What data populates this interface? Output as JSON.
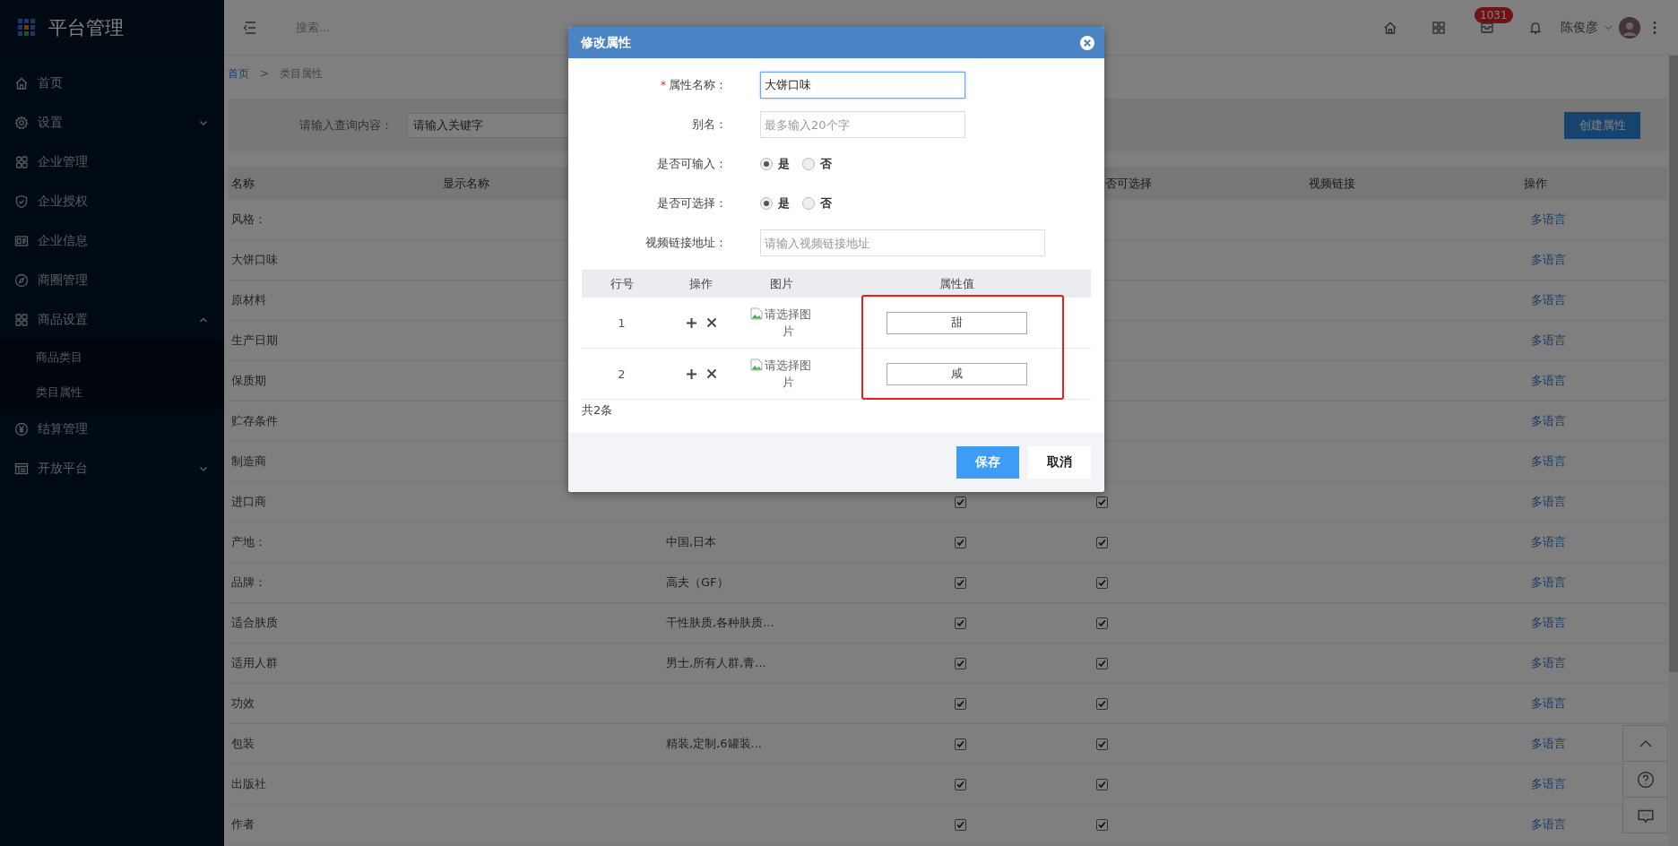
{
  "sidebar": {
    "title": "平台管理",
    "items": [
      {
        "label": "首页"
      },
      {
        "label": "设置",
        "expanded": false
      },
      {
        "label": "企业管理"
      },
      {
        "label": "企业授权"
      },
      {
        "label": "企业信息"
      },
      {
        "label": "商圈管理"
      },
      {
        "label": "商品设置",
        "expanded": true,
        "children": [
          {
            "label": "商品类目"
          },
          {
            "label": "类目属性"
          }
        ]
      },
      {
        "label": "结算管理"
      },
      {
        "label": "开放平台",
        "expanded": false
      }
    ]
  },
  "header": {
    "search_placeholder": "搜索...",
    "badge": "1031",
    "user": "陈俊彦"
  },
  "breadcrumb": {
    "home": "首页",
    "separator": ">",
    "current": "类目属性"
  },
  "filter": {
    "label": "请输入查询内容：",
    "placeholder": "请输入关键字",
    "create_button": "创建属性"
  },
  "table": {
    "columns": {
      "name": "名称",
      "display_name": "显示名称",
      "column_5": "否可选择",
      "video": "视频链接",
      "actions": "操作"
    },
    "rows": [
      {
        "name": "风格：",
        "link": "多语言"
      },
      {
        "name": "大饼口味",
        "link": "多语言"
      },
      {
        "name": "原材料",
        "link": "多语言"
      },
      {
        "name": "生产日期",
        "link": "多语言"
      },
      {
        "name": "保质期",
        "link": "多语言"
      },
      {
        "name": "贮存条件",
        "link": "多语言"
      },
      {
        "name": "制造商",
        "link": "多语言"
      },
      {
        "name": "进口商",
        "column_4_checked": true,
        "column_5_checked": true,
        "link": "多语言"
      },
      {
        "name": "产地：",
        "values": "中国,日本",
        "column_4_checked": true,
        "column_5_checked": true,
        "link": "多语言"
      },
      {
        "name": "品牌：",
        "values": "高夫（GF）",
        "column_4_checked": true,
        "column_5_checked": true,
        "link": "多语言"
      },
      {
        "name": "适合肤质",
        "values": "干性肤质,各种肤质...",
        "column_4_checked": true,
        "column_5_checked": true,
        "link": "多语言"
      },
      {
        "name": "适用人群",
        "values": "男士,所有人群,青...",
        "column_4_checked": true,
        "column_5_checked": true,
        "link": "多语言"
      },
      {
        "name": "功效",
        "column_4_checked": true,
        "column_5_checked": true,
        "link": "多语言"
      },
      {
        "name": "包装",
        "values": "精装,定制,6罐装...",
        "column_4_checked": true,
        "column_5_checked": true,
        "link": "多语言"
      },
      {
        "name": "出版社",
        "column_4_checked": true,
        "column_5_checked": true,
        "link": "多语言"
      },
      {
        "name": "作者",
        "column_4_checked": true,
        "column_5_checked": true,
        "link": "多语言"
      }
    ]
  },
  "dialog": {
    "title": "修改属性",
    "form": [
      {
        "kind": "text",
        "label": "属性名称：",
        "required_mark": "*",
        "value": "大饼口味",
        "focused": true
      },
      {
        "kind": "text",
        "label": "别名：",
        "placeholder": "最多输入20个字",
        "focused": false
      },
      {
        "kind": "radio",
        "label": "是否可输入：",
        "options": [
          {
            "label": "是",
            "selected": true
          },
          {
            "label": "否",
            "selected": false
          }
        ]
      },
      {
        "kind": "radio",
        "label": "是否可选择：",
        "options": [
          {
            "label": "是",
            "selected": true
          },
          {
            "label": "否",
            "selected": false
          }
        ]
      },
      {
        "kind": "url",
        "label": "视频链接地址：",
        "placeholder": "请输入视频链接地址",
        "focused": false
      }
    ],
    "values_table": {
      "columns": [
        "行号",
        "操作",
        "图片",
        "属性值"
      ],
      "rows": [
        {
          "index": "1",
          "image_alt": "请选择图片",
          "value": "甜"
        },
        {
          "index": "2",
          "image_alt": "请选择图片",
          "value": "咸"
        }
      ]
    },
    "total": "共2条",
    "buttons": {
      "save": "保存",
      "cancel": "取消"
    }
  }
}
